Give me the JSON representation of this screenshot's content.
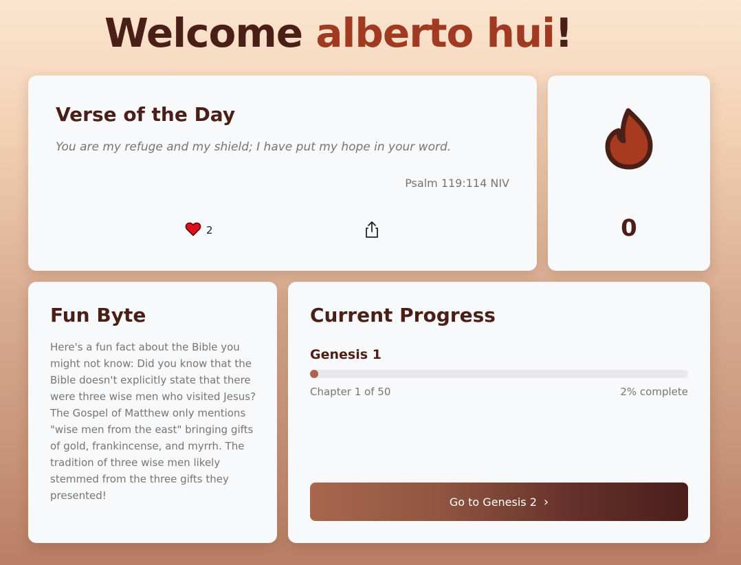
{
  "header": {
    "greeting": "Welcome",
    "username": "alberto hui",
    "punctuation": "!"
  },
  "verse": {
    "title": "Verse of the Day",
    "text": "You are my refuge and my shield; I have put my hope in your word.",
    "reference": "Psalm 119:114 NIV",
    "likes": "2",
    "like_icon": "heart-icon",
    "share_icon": "share-icon"
  },
  "streak": {
    "icon": "flame-icon",
    "count": "0"
  },
  "fun_byte": {
    "title": "Fun Byte",
    "text": "Here's a fun fact about the Bible you might not know: Did you know that the Bible doesn't explicitly state that there were three wise men who visited Jesus? The Gospel of Matthew only mentions \"wise men from the east\" bringing gifts of gold, frankincense, and myrrh. The tradition of three wise men likely stemmed from the three gifts they presented!"
  },
  "progress": {
    "title": "Current Progress",
    "book": "Genesis 1",
    "chapter_label": "Chapter 1 of 50",
    "percent_label": "2% complete",
    "percent": 2,
    "button_label": "Go to Genesis 2",
    "button_icon": "chevron-right-icon"
  },
  "colors": {
    "heading": "#4a1f18",
    "accent": "#a03a22",
    "heart": "#e0101a",
    "progress_fill": "#a8644e"
  }
}
